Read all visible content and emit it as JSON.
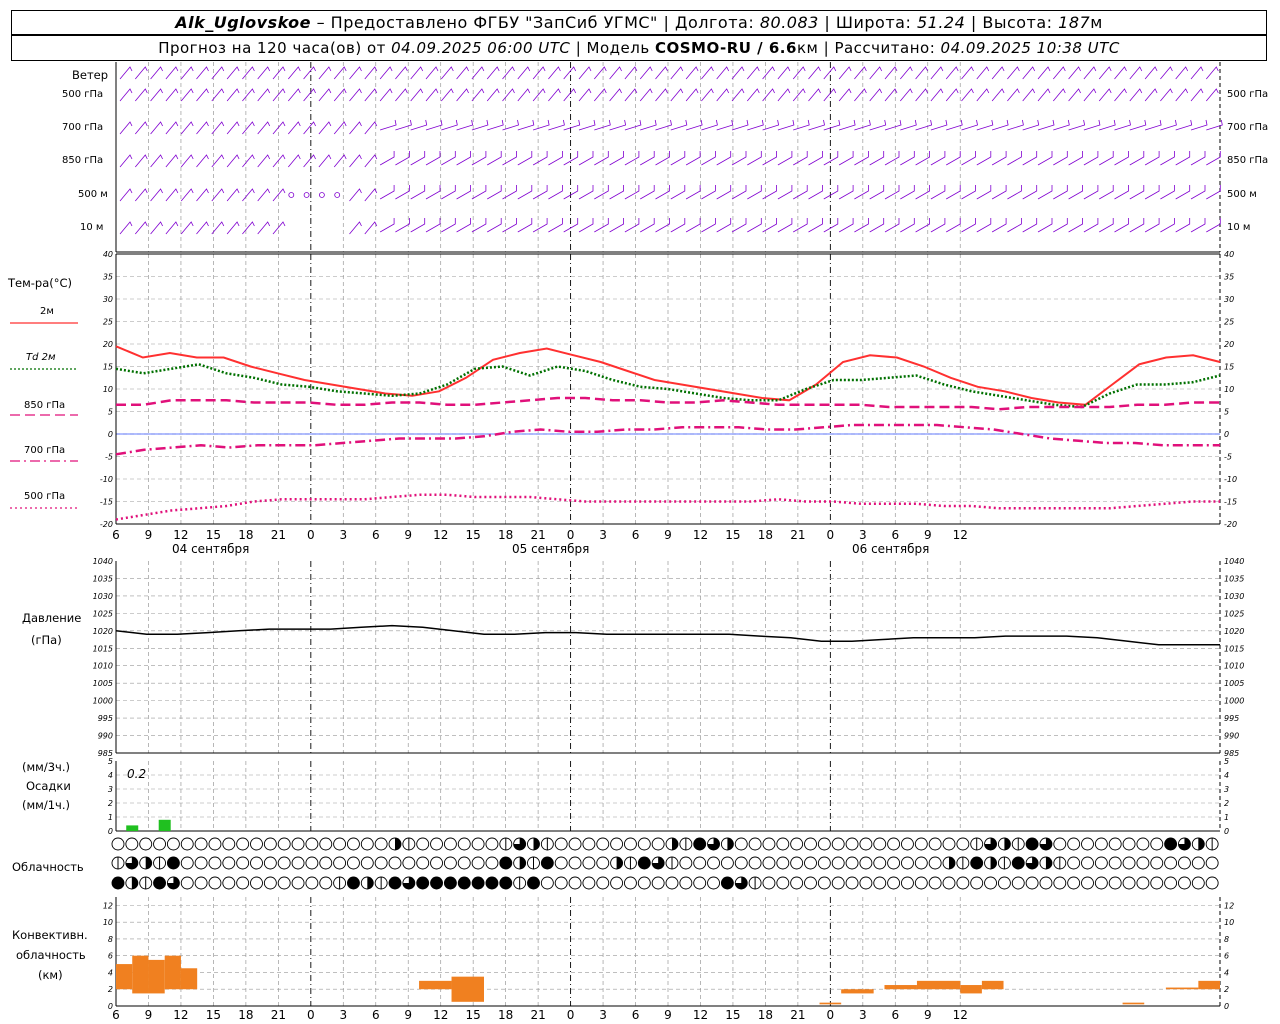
{
  "header": {
    "station": "Alk_Uglovskoe",
    "provided_by": "– Предоставлено ФГБУ \"ЗапСиб УГМС\"",
    "lon_label": "Долгота:",
    "lon_value": "80.083",
    "lat_label": "Широта:",
    "lat_value": "51.24",
    "alt_label": "Высота:",
    "alt_value": "187",
    "alt_unit": "м",
    "forecast_label": "Прогноз на 120 часа(ов) от",
    "forecast_start": "04.09.2025 06:00 UTC",
    "model_label": "Модель",
    "model_name": "COSMO-RU / 6.6",
    "model_unit": "км",
    "calc_label": "Рассчитано:",
    "calc_time": "04.09.2025 10:38 UTC"
  },
  "wind_panel": {
    "title": "Ветер",
    "levels": [
      "500 гПа",
      "700 гПа",
      "850 гПа",
      "500 м",
      "10 м"
    ],
    "levels_right": [
      "500 гПа",
      "700 гПа",
      "850 гПа",
      "500 м",
      "10 м"
    ],
    "barb_color": "#8000d0"
  },
  "temp_panel": {
    "ylabel": "Тем-ра(°C)",
    "legend": [
      {
        "name": "2м",
        "color": "#ff3030",
        "style": "solid"
      },
      {
        "name": "Td  2м",
        "color": "#007000",
        "style": "dotted"
      },
      {
        "name": "850 гПа",
        "color": "#e0107a",
        "style": "dash"
      },
      {
        "name": "700 гПа",
        "color": "#e0107a",
        "style": "dashdot"
      },
      {
        "name": "500 гПа",
        "color": "#e0107a",
        "style": "dot"
      }
    ],
    "yticks": [
      "40",
      "35",
      "30",
      "25",
      "20",
      "15",
      "10",
      "5",
      "0",
      "-5",
      "-10",
      "-15",
      "-20"
    ],
    "day_labels": [
      "04 сентября",
      "05 сентября",
      "06 сентября"
    ]
  },
  "time_axis": {
    "hours": [
      "6",
      "9",
      "12",
      "15",
      "18",
      "21",
      "0",
      "3",
      "6",
      "9",
      "12",
      "15",
      "18",
      "21",
      "0",
      "3",
      "6",
      "9",
      "12",
      "15",
      "18",
      "21",
      "0",
      "3",
      "6",
      "9",
      "12"
    ]
  },
  "pressure_panel": {
    "ylabel": "Давление",
    "unit": "(гПа)",
    "yticks": [
      "1040",
      "1035",
      "1030",
      "1025",
      "1020",
      "1015",
      "1010",
      "1005",
      "1000",
      "995",
      "990",
      "985"
    ]
  },
  "precip_panel": {
    "ylabel1": "(мм/3ч.)",
    "ylabel2": "Осадки",
    "ylabel3": "(мм/1ч.)",
    "yticks": [
      "5",
      "4",
      "3",
      "2",
      "1",
      "0"
    ],
    "annotation": "0.2",
    "color": "#20c020"
  },
  "cloud_panel": {
    "ylabel": "Облачность"
  },
  "conv_panel": {
    "ylabel1": "Конвективн.",
    "ylabel2": "облачность",
    "ylabel3": "(км)",
    "yticks": [
      "12",
      "10",
      "8",
      "6",
      "4",
      "2",
      "0"
    ],
    "color": "#f08020"
  },
  "chart_data": [
    {
      "type": "line",
      "title": "Тем-ра(°C)",
      "x_hours_from_start": [
        0,
        3,
        6,
        9,
        12,
        15,
        18,
        21,
        24,
        27,
        30,
        33,
        36,
        39,
        42,
        45,
        48,
        51,
        54,
        57,
        60,
        63,
        66,
        69,
        72,
        75,
        78,
        81,
        84,
        87,
        90,
        93,
        96,
        99,
        102,
        105,
        108,
        111,
        114
      ],
      "ylim": [
        -20,
        40
      ],
      "series": [
        {
          "name": "2м",
          "values": [
            19.5,
            17,
            18,
            17,
            17,
            15,
            13.5,
            12,
            11,
            10,
            9,
            8.5,
            9.5,
            12.5,
            16.5,
            18,
            19,
            17.5,
            16,
            14,
            12,
            11,
            10,
            9,
            8,
            7.5,
            11,
            16,
            17.5,
            17,
            15,
            12.5,
            10.5,
            9.5,
            8,
            7,
            6.5,
            11,
            15.5,
            17,
            17.5,
            16
          ]
        },
        {
          "name": "Td  2м",
          "values": [
            14.5,
            13.5,
            14.5,
            15.5,
            13.5,
            12.5,
            11,
            10.5,
            9.5,
            9,
            8.5,
            9,
            11,
            14.5,
            15,
            13,
            15,
            14,
            12,
            10.5,
            10,
            9,
            8,
            7.5,
            7.5,
            10,
            12,
            12,
            12.5,
            13,
            11,
            9.5,
            8.5,
            7.5,
            6.5,
            6,
            9,
            11,
            11,
            11.5,
            13
          ]
        },
        {
          "name": "850 гПа",
          "values": [
            6.5,
            6.5,
            7.5,
            7.5,
            7.5,
            7,
            7,
            7,
            6.5,
            6.5,
            7,
            7,
            6.5,
            6.5,
            7,
            7.5,
            8,
            8,
            7.5,
            7.5,
            7,
            7,
            7.5,
            7,
            6.5,
            6.5,
            6.5,
            6.5,
            6,
            6,
            6,
            6,
            5.5,
            6,
            6,
            6,
            6,
            6.5,
            6.5,
            7,
            7
          ]
        },
        {
          "name": "700 гПа",
          "values": [
            -4.5,
            -3.5,
            -3,
            -2.5,
            -3,
            -2.5,
            -2.5,
            -2.5,
            -2,
            -1.5,
            -1,
            -1,
            -1,
            -0.5,
            0.5,
            1,
            0.5,
            0.5,
            1,
            1,
            1.5,
            1.5,
            1.5,
            1,
            1,
            1.5,
            2,
            2,
            2,
            2,
            1.5,
            1,
            0,
            -1,
            -1.5,
            -2,
            -2,
            -2.5,
            -2.5,
            -2.5
          ]
        },
        {
          "name": "500 гПа",
          "values": [
            -19,
            -18,
            -17,
            -16.5,
            -16,
            -15,
            -14.5,
            -14.5,
            -14.5,
            -14.5,
            -14,
            -13.5,
            -13.5,
            -14,
            -14,
            -14,
            -14.5,
            -15,
            -15,
            -15,
            -15,
            -15,
            -15,
            -15,
            -14.5,
            -15,
            -15,
            -15.5,
            -15.5,
            -15.5,
            -16,
            -16,
            -16.5,
            -16.5,
            -16.5,
            -16.5,
            -16.5,
            -16,
            -15.5,
            -15,
            -15
          ]
        }
      ]
    },
    {
      "type": "line",
      "title": "Давление",
      "ylabel": "(гПа)",
      "ylim": [
        985,
        1040
      ],
      "series": [
        {
          "name": "Давление",
          "values": [
            1020,
            1019,
            1019,
            1019.5,
            1020,
            1020.5,
            1020.5,
            1020.5,
            1021,
            1021.5,
            1021,
            1020,
            1019,
            1019,
            1019.5,
            1019.5,
            1019,
            1019,
            1019,
            1019,
            1019,
            1018.5,
            1018,
            1017,
            1017,
            1017.5,
            1018,
            1018,
            1018,
            1018.5,
            1018.5,
            1018.5,
            1018,
            1017,
            1016,
            1016,
            1016
          ]
        }
      ]
    },
    {
      "type": "bar",
      "title": "Осадки",
      "ylabel": "(мм/3ч.)",
      "ylim": [
        0,
        5
      ],
      "categories": [
        "6",
        "9"
      ],
      "values": [
        0.1,
        0.2
      ]
    },
    {
      "type": "bar",
      "title": "Конвективн. облачность",
      "ylabel": "(км)",
      "ylim": [
        0,
        12
      ],
      "series": [
        {
          "name": "base",
          "values": [
            2,
            1.5,
            1.5,
            2,
            2,
            2,
            0.5,
            1.5,
            2,
            2,
            1.5
          ]
        },
        {
          "name": "top",
          "values": [
            5,
            6,
            5.5,
            6,
            4.5,
            3,
            3.5,
            1.5,
            2.5,
            3,
            2.5
          ]
        }
      ]
    }
  ]
}
